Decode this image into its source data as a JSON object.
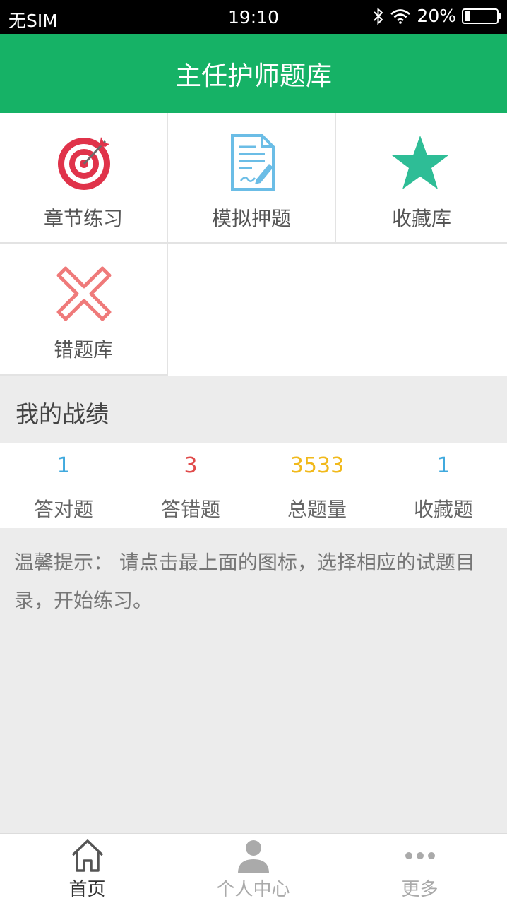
{
  "status_bar": {
    "carrier": "无SIM",
    "time": "19:10",
    "battery": "20%"
  },
  "nav": {
    "title": "主任护师题库"
  },
  "grid": {
    "items": [
      {
        "label": "章节练习",
        "icon": "target-icon",
        "color": "#e0334a"
      },
      {
        "label": "模拟押题",
        "icon": "document-pen-icon",
        "color": "#6bbde6"
      },
      {
        "label": "收藏库",
        "icon": "star-icon",
        "color": "#2ebd96"
      },
      {
        "label": "错题库",
        "icon": "close-icon",
        "color": "#ef7a7a"
      }
    ]
  },
  "stats_section": {
    "title": "我的战绩",
    "items": [
      {
        "value": "1",
        "label": "答对题",
        "color": "#3fa9de"
      },
      {
        "value": "3",
        "label": "答错题",
        "color": "#e04a4a"
      },
      {
        "value": "3533",
        "label": "总题量",
        "color": "#f1b91b"
      },
      {
        "value": "1",
        "label": "收藏题",
        "color": "#3fa9de"
      }
    ]
  },
  "tip": {
    "text": "温馨提示： 请点击最上面的图标，选择相应的试题目录，开始练习。"
  },
  "tabs": [
    {
      "label": "首页",
      "icon": "home-icon",
      "active": true,
      "color": "#333333"
    },
    {
      "label": "个人中心",
      "icon": "user-icon",
      "active": false,
      "color": "#aaaaaa"
    },
    {
      "label": "更多",
      "icon": "more-icon",
      "active": false,
      "color": "#aaaaaa"
    }
  ]
}
